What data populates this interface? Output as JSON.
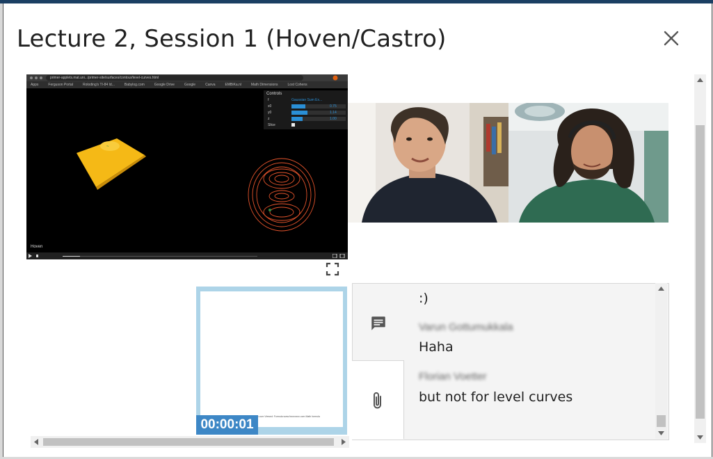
{
  "modal": {
    "title": "Lecture 2, Session 1 (Hoven/Castro)",
    "close_icon": "close-icon"
  },
  "screenshare": {
    "url": "primer-applets.mat.uni.../primer-site/surfaces/contour/level-curves.html",
    "bookmarks": [
      "Apps",
      "Ferguson Portal",
      "Roloding's TI-84 Id...",
      "Babylog.com",
      "Google Drive",
      "Google",
      "Canva",
      "EMBiKa.nl",
      "Math Dimensions",
      "Lost Cohens"
    ],
    "controls_title": "Controls",
    "controls": [
      {
        "label": "f",
        "value": "Gaussian Sum Ex..."
      },
      {
        "label": "x0",
        "value": "0.75",
        "fraction": 0.25
      },
      {
        "label": "y0",
        "value": "1.14",
        "fraction": 0.3
      },
      {
        "label": "z",
        "value": "1.00",
        "fraction": 0.2
      },
      {
        "label": "Slice",
        "value": ""
      }
    ],
    "playback_position": 0.09,
    "watermark": "Hoven"
  },
  "slide": {
    "caption": "Taken on Textbooks www.xxxxxx.com Viewed: Formula www.fxxxxxxxx.com Math formula",
    "timer": "00:00:01"
  },
  "chat": {
    "messages": [
      {
        "author": "",
        "text": ":)"
      },
      {
        "author": "Varun Gottumukkala",
        "text": "Haha"
      },
      {
        "author": "Florian Voetter",
        "text": "but not for level curves"
      }
    ],
    "chat_icon": "chat-icon",
    "attach_icon": "paperclip-icon"
  },
  "colors": {
    "header_stripe": "#1b3f63",
    "slide_border": "#add4e8",
    "timer_badge": "#3d87c6",
    "chat_bg": "#f4f4f4",
    "surface": "#f5b916",
    "contour": "#e5542c"
  }
}
